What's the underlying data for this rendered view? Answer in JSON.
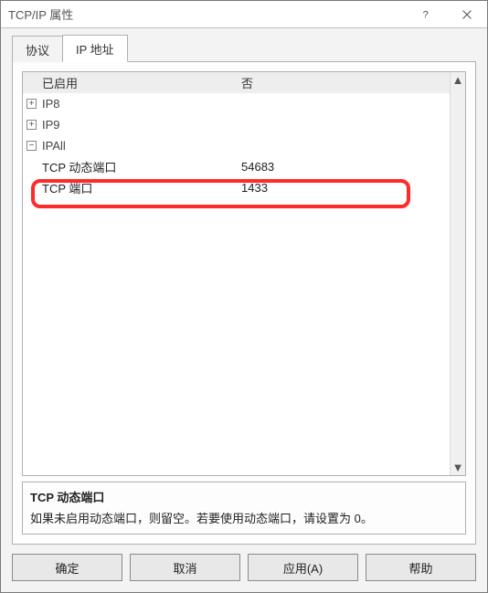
{
  "window": {
    "title": "TCP/IP 属性"
  },
  "tabs": {
    "protocol": "协议",
    "ip": "IP 地址"
  },
  "grid": {
    "enabled_label": "已启用",
    "enabled_value": "否",
    "ip8_label": "IP8",
    "ip9_label": "IP9",
    "ipall_label": "IPAll",
    "dynport_label": "TCP 动态端口",
    "dynport_value": "54683",
    "port_label": "TCP 端口",
    "port_value": "1433"
  },
  "toggle": {
    "plus": "+",
    "minus": "−"
  },
  "description": {
    "title": "TCP 动态端口",
    "text": "如果未启用动态端口，则留空。若要使用动态端口，请设置为 0。"
  },
  "buttons": {
    "ok": "确定",
    "cancel": "取消",
    "apply": "应用(A)",
    "help": "帮助"
  },
  "scrollbar": {
    "up": "▲",
    "down": "▼"
  }
}
